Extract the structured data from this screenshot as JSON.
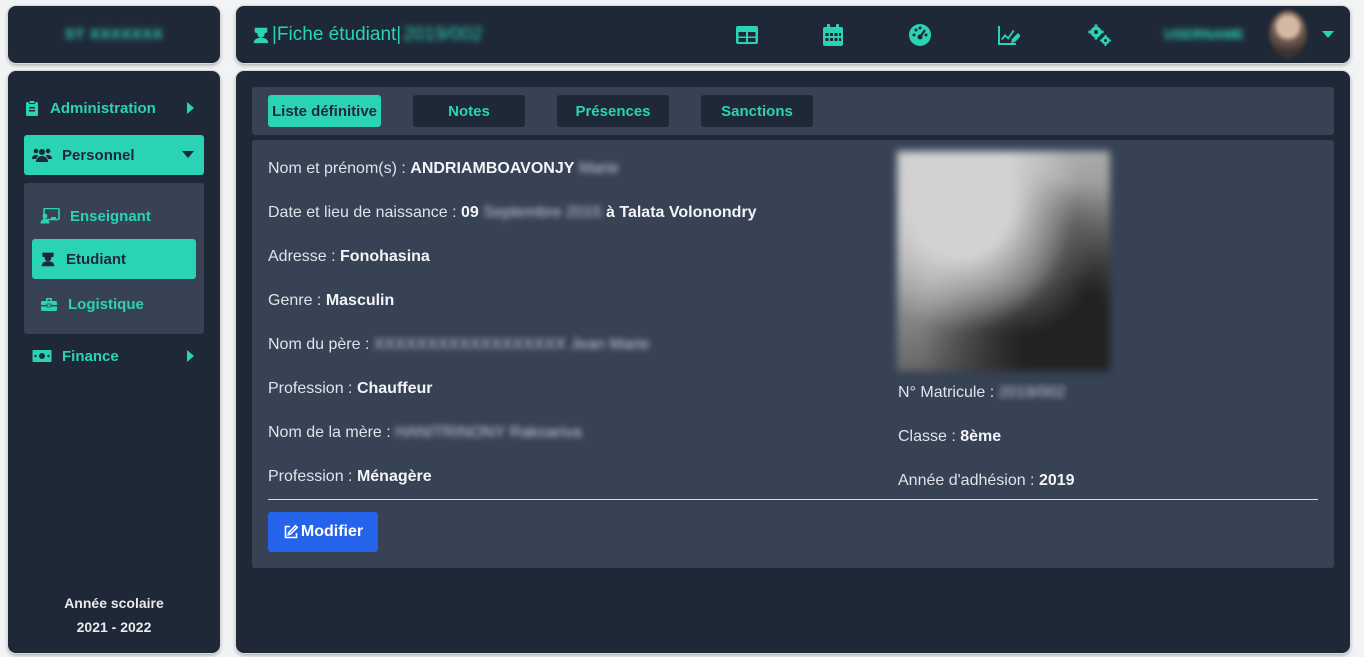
{
  "brand": {
    "text": "ST XXXXXXX"
  },
  "header": {
    "title_prefix": "|Fiche étudiant|",
    "title_id": "2019/002",
    "icons": [
      "table-icon",
      "calendar-icon",
      "dashboard-icon",
      "chart-edit-icon",
      "cogs-icon"
    ],
    "user_name": "USERNAME"
  },
  "sidebar": {
    "items": [
      {
        "label": "Administration",
        "icon": "clipboard-icon"
      },
      {
        "label": "Personnel",
        "icon": "users-icon"
      },
      {
        "label": "Enseignant",
        "icon": "teacher-icon"
      },
      {
        "label": "Etudiant",
        "icon": "student-icon"
      },
      {
        "label": "Logistique",
        "icon": "toolbox-icon"
      },
      {
        "label": "Finance",
        "icon": "money-icon"
      }
    ],
    "school_year_label": "Année scolaire",
    "school_year_value": "2021 - 2022"
  },
  "tabs": [
    {
      "label": "Liste définitive",
      "active": true
    },
    {
      "label": "Notes",
      "active": false
    },
    {
      "label": "Présences",
      "active": false
    },
    {
      "label": "Sanctions",
      "active": false
    }
  ],
  "student": {
    "name_label": "Nom et prénom(s) : ",
    "name_value": "ANDRIAMBOAVONJY",
    "name_hidden": "Marie",
    "birth_label": "Date et lieu de naissance : ",
    "birth_day": "09",
    "birth_hidden": "Septembre 2015",
    "birth_place": "à Talata Volonondry",
    "address_label": "Adresse : ",
    "address_value": "Fonohasina",
    "gender_label": "Genre : ",
    "gender_value": "Masculin",
    "father_label": "Nom du père : ",
    "father_hidden_1": "XXXXXXXXXXXXXXXXXX",
    "father_hidden_2": "Jean Marie",
    "father_job_label": "Profession : ",
    "father_job_value": "Chauffeur",
    "mother_label": "Nom de la mère : ",
    "mother_hidden": "HANITRINONY Rakoariva",
    "mother_job_label": "Profession : ",
    "mother_job_value": "Ménagère",
    "matricule_label": "N° Matricule : ",
    "matricule_value": "2019/002",
    "class_label": "Classe : ",
    "class_value": "8ème",
    "join_label": "Année d'adhésion : ",
    "join_value": "2019"
  },
  "actions": {
    "modify_label": "Modifier"
  },
  "colors": {
    "accent": "#2bd3b5",
    "panel": "#1f2837",
    "card": "#374255",
    "button": "#2563eb"
  }
}
